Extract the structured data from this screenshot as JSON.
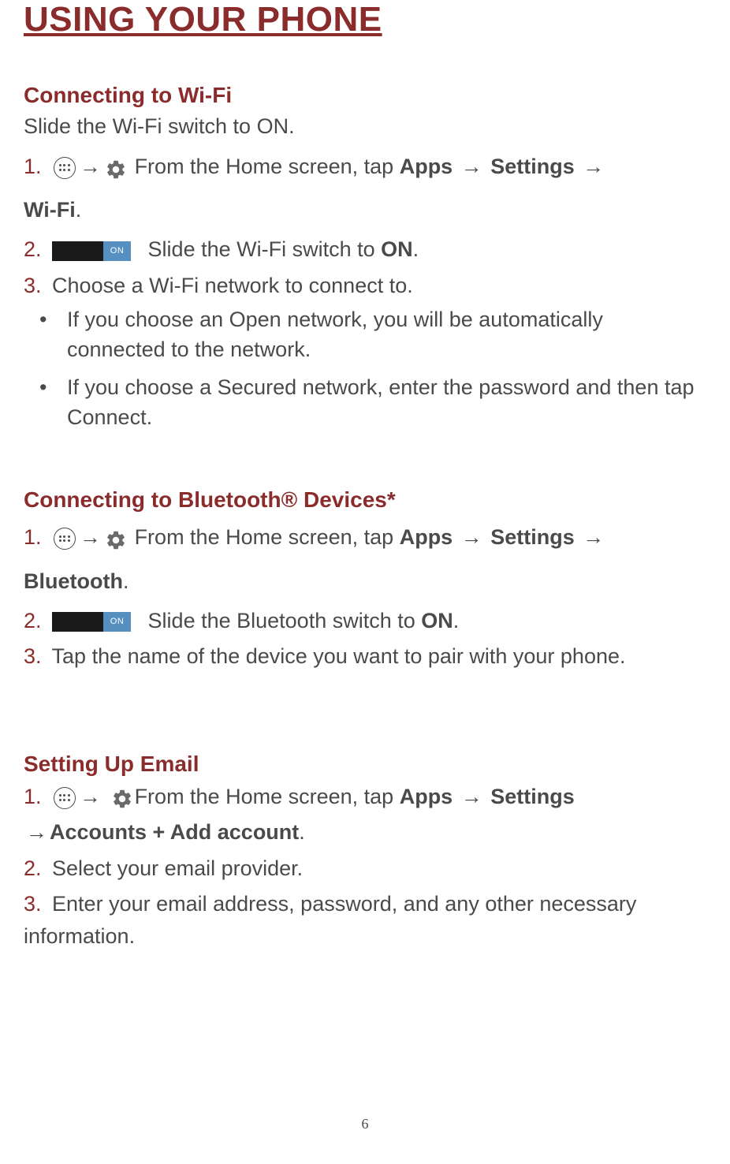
{
  "page_title": "USING YOUR PHONE",
  "page_number": "6",
  "sections": {
    "wifi": {
      "title": "Connecting to Wi-Fi",
      "intro": "Slide the Wi-Fi switch to ON.",
      "step1_num": "1.",
      "step1_text_a": "From the Home screen, tap ",
      "step1_apps": "Apps",
      "step1_settings": " Settings ",
      "continuation_bold": "Wi-Fi",
      "continuation_period": ".",
      "step2_num": "2.",
      "step2_text": " Slide the Wi-Fi switch to ",
      "step2_on": "ON",
      "step2_period": ".",
      "switch_label": "ON",
      "step3_num": "3.",
      "step3_text": " Choose a Wi-Fi network to connect to.",
      "bullet1": "If you choose an Open network, you will be automatically connected to the network.",
      "bullet2": "If you choose a Secured network, enter the password and then tap Connect."
    },
    "bluetooth": {
      "title": "Connecting to Bluetooth® Devices*",
      "step1_num": "1.",
      "step1_text_a": "From the Home screen, tap ",
      "step1_apps": "Apps",
      "step1_settings": " Settings ",
      "continuation_bold": "Bluetooth",
      "continuation_period": ".",
      "step2_num": "2.",
      "step2_text": " Slide the Bluetooth switch to ",
      "step2_on": "ON",
      "step2_period": ".",
      "switch_label": "ON",
      "step3_num": "3.",
      "step3_text": " Tap the name of the device you want to pair with your phone."
    },
    "email": {
      "title": "Setting Up Email",
      "step1_num": "1.",
      "step1_text_a": "From the Home screen, tap ",
      "step1_apps": "Apps",
      "step1_settings": " Settings ",
      "cont_arrow": "→",
      "cont_accounts": "Accounts + Add account",
      "cont_period": ".",
      "step2_num": "2.",
      "step2_text": " Select your email provider.",
      "step3_num": "3.",
      "step3_text": " Enter your email address, password, and any other necessary information."
    }
  },
  "icons": {
    "arrow": "→"
  }
}
